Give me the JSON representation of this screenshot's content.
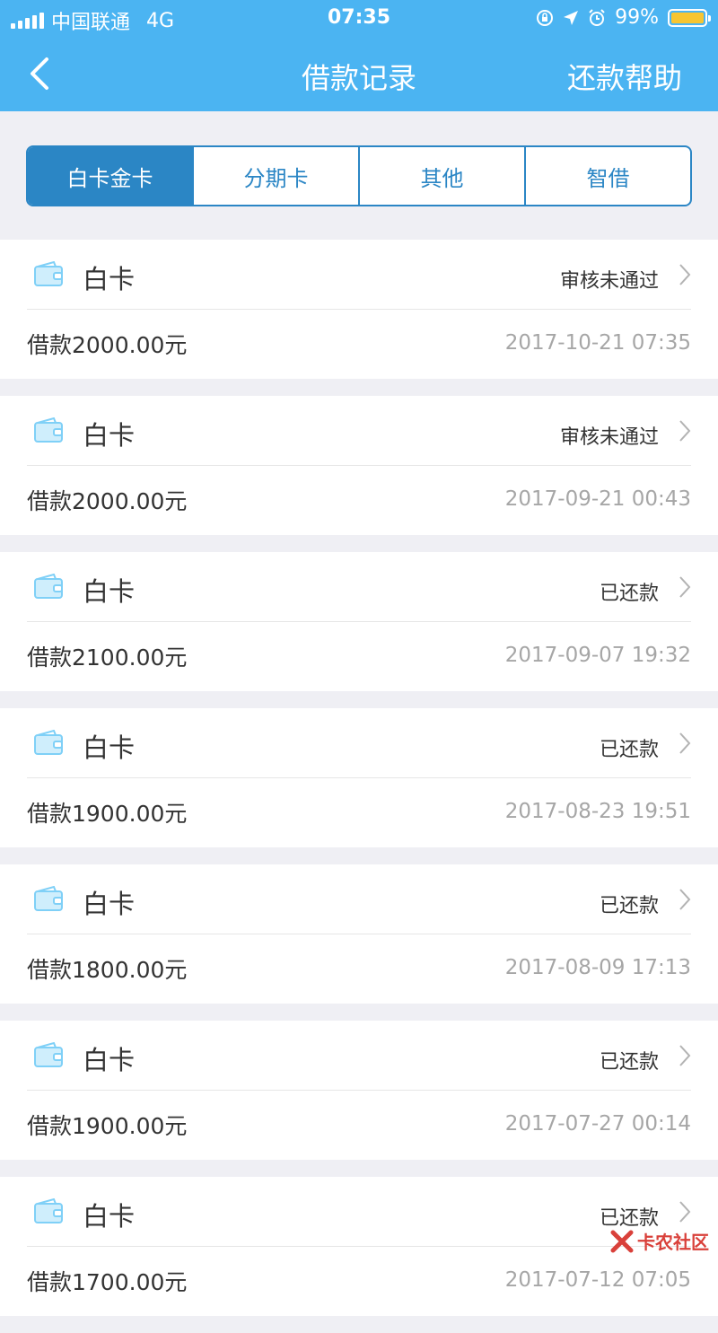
{
  "status_bar": {
    "carrier": "中国联通",
    "network": "4G",
    "time": "07:35",
    "battery": "99%"
  },
  "nav": {
    "title": "借款记录",
    "right_action": "还款帮助"
  },
  "tabs": [
    {
      "label": "白卡金卡",
      "active": true
    },
    {
      "label": "分期卡",
      "active": false
    },
    {
      "label": "其他",
      "active": false
    },
    {
      "label": "智借",
      "active": false
    }
  ],
  "records": [
    {
      "card": "白卡",
      "status": "审核未通过",
      "amount": "借款2000.00元",
      "date": "2017-10-21 07:35"
    },
    {
      "card": "白卡",
      "status": "审核未通过",
      "amount": "借款2000.00元",
      "date": "2017-09-21 00:43"
    },
    {
      "card": "白卡",
      "status": "已还款",
      "amount": "借款2100.00元",
      "date": "2017-09-07 19:32"
    },
    {
      "card": "白卡",
      "status": "已还款",
      "amount": "借款1900.00元",
      "date": "2017-08-23 19:51"
    },
    {
      "card": "白卡",
      "status": "已还款",
      "amount": "借款1800.00元",
      "date": "2017-08-09 17:13"
    },
    {
      "card": "白卡",
      "status": "已还款",
      "amount": "借款1900.00元",
      "date": "2017-07-27 00:14"
    },
    {
      "card": "白卡",
      "status": "已还款",
      "amount": "借款1700.00元",
      "date": "2017-07-12 07:05"
    }
  ],
  "watermark": {
    "text": "卡农社区"
  },
  "colors": {
    "nav_bg": "#4bb4f2",
    "tab_accent": "#2b86c5",
    "page_bg": "#efeff4",
    "battery": "#f7c531"
  }
}
